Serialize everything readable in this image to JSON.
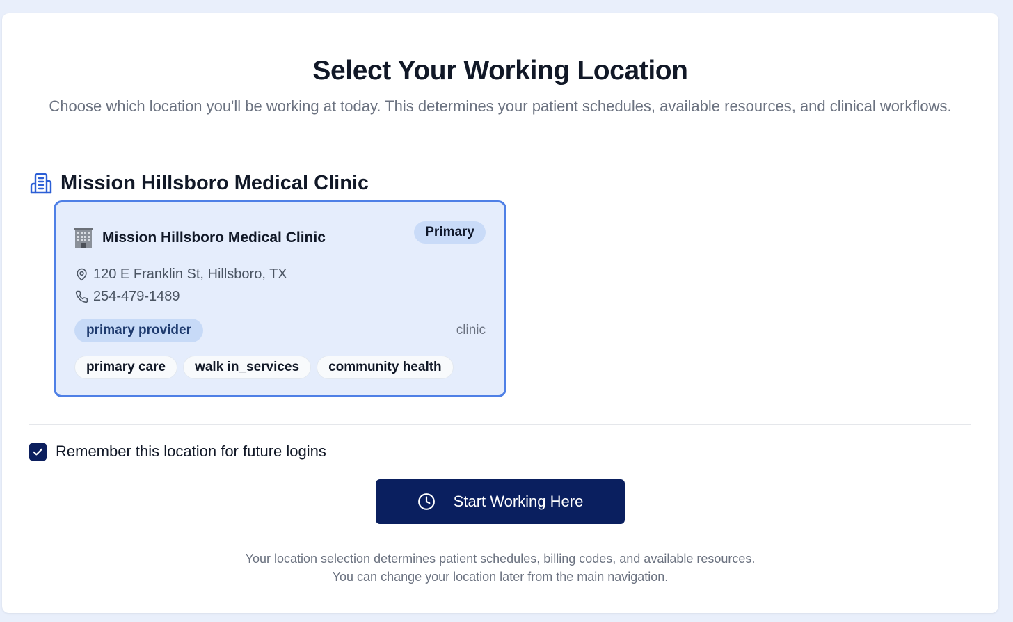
{
  "header": {
    "title": "Select Your Working Location",
    "subtitle": "Choose which location you'll be working at today. This determines your patient schedules, available resources, and clinical workflows."
  },
  "organization": {
    "icon": "building-icon",
    "name": "Mission Hillsboro Medical Clinic"
  },
  "location_card": {
    "selected": true,
    "icon": "building-emoji",
    "name": "Mission Hillsboro Medical Clinic",
    "badge": "Primary",
    "address_icon": "map-pin-icon",
    "address": "120 E Franklin St, Hillsboro, TX",
    "phone_icon": "phone-icon",
    "phone": "254-479-1489",
    "role": "primary provider",
    "type": "clinic",
    "tags": [
      "primary care",
      "walk in_services",
      "community health"
    ]
  },
  "remember": {
    "checked": true,
    "label": "Remember this location for future logins"
  },
  "start_button": {
    "icon": "clock-icon",
    "label": "Start Working Here"
  },
  "footnote": {
    "line1": "Your location selection determines patient schedules, billing codes, and available resources.",
    "line2": "You can change your location later from the main navigation."
  },
  "colors": {
    "page_bg": "#e9effb",
    "accent_navy": "#0a1f5f",
    "card_bg": "#e5edfc",
    "card_border": "#4f80e6",
    "icon_blue": "#2c5fd6"
  }
}
